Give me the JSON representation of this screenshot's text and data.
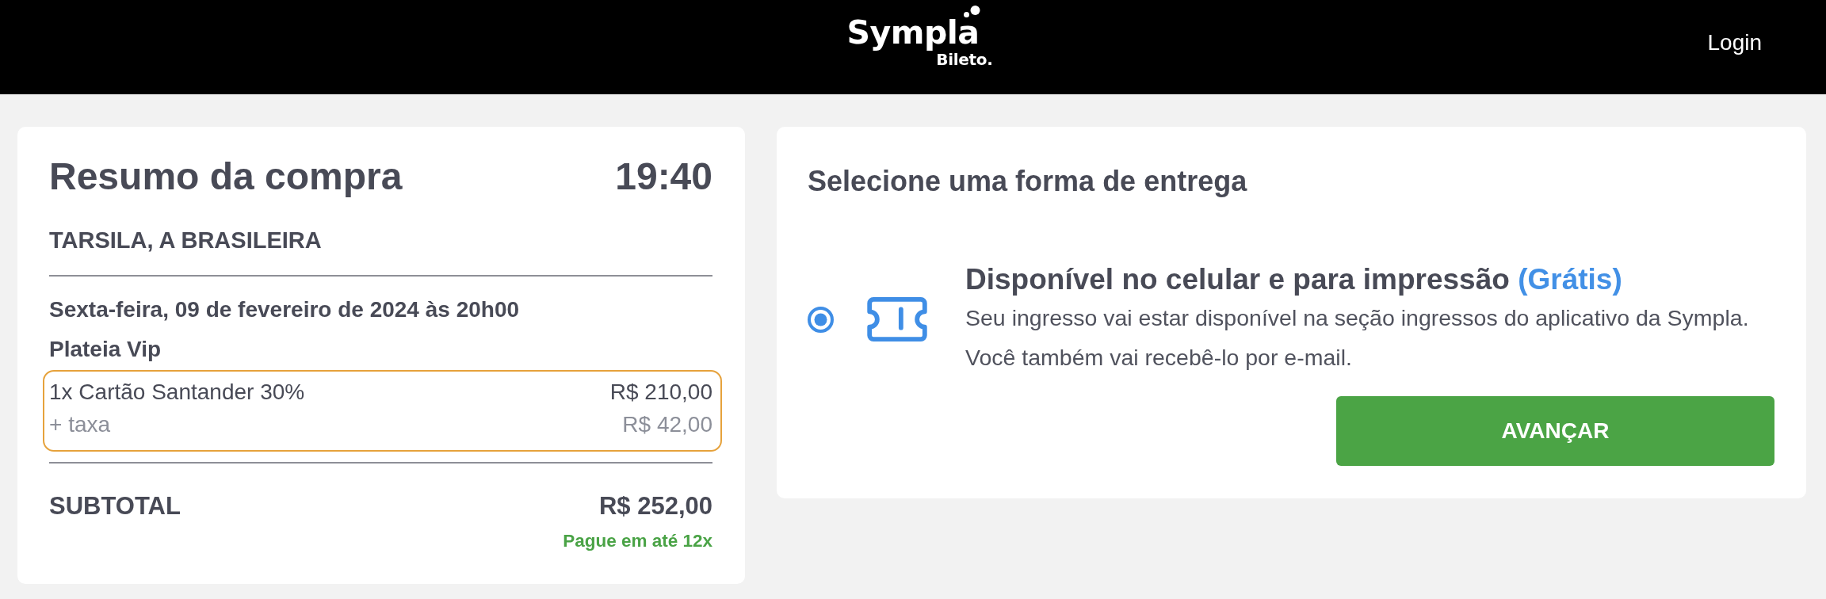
{
  "header": {
    "logo": {
      "brand": "Sympla",
      "sub_brand": "Bileto."
    },
    "login_link": "Login"
  },
  "summary": {
    "title": "Resumo da compra",
    "timer": "19:40",
    "event_name": "TARSILA, A BRASILEIRA",
    "session_date": "Sexta-feira, 09 de fevereiro de 2024 às 20h00",
    "sector": "Plateia Vip",
    "items": [
      {
        "label": "1x Cartão Santander 30%",
        "price": "R$ 210,00",
        "fee_label": "+ taxa",
        "fee": "R$ 42,00",
        "highlighted": true
      }
    ],
    "subtotal_label": "SUBTOTAL",
    "subtotal": "R$ 252,00",
    "installments_note": "Pague em até 12x"
  },
  "delivery": {
    "heading": "Selecione uma forma de entrega",
    "options": [
      {
        "title": "Disponível no celular e para impressão",
        "price_tag": "(Grátis)",
        "description_lines": [
          "Seu ingresso vai estar disponível na seção ingressos do aplicativo da Sympla.",
          "Você também vai recebê-lo por e-mail."
        ],
        "selected": true
      }
    ],
    "button": "AVANÇAR"
  }
}
